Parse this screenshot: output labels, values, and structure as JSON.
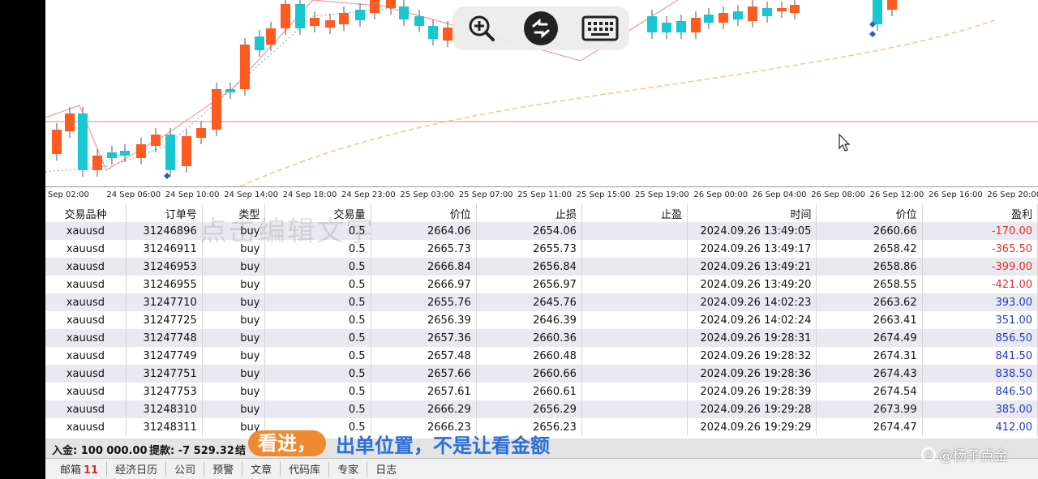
{
  "chart": {
    "time_labels": [
      "Sep 02:00",
      "24 Sep 06:00",
      "24 Sep 10:00",
      "24 Sep 14:00",
      "24 Sep 18:00",
      "24 Sep 23:00",
      "25 Sep 03:00",
      "25 Sep 07:00",
      "25 Sep 11:00",
      "25 Sep 15:00",
      "25 Sep 19:00",
      "26 Sep 00:00",
      "26 Sep 04:00",
      "26 Sep 08:00",
      "26 Sep 12:00",
      "26 Sep 16:00",
      "26 Sep 20:00"
    ]
  },
  "toolbar": {
    "zoom_icon": "zoom-in-icon",
    "remote_icon": "remote-desktop-icon",
    "keyboard_icon": "keyboard-icon"
  },
  "table": {
    "headers": [
      "交易品种",
      "订单号",
      "类型",
      "交易量",
      "价位",
      "止损",
      "止盈",
      "时间",
      "价位",
      "盈利"
    ],
    "rows": [
      {
        "symbol": "xauusd",
        "order": "31246896",
        "type": "buy",
        "volume": "0.5",
        "price": "2664.06",
        "sl": "2654.06",
        "tp": "",
        "time": "2024.09.26 13:49:05",
        "current": "2660.66",
        "profit": "-170.00"
      },
      {
        "symbol": "xauusd",
        "order": "31246911",
        "type": "buy",
        "volume": "0.5",
        "price": "2665.73",
        "sl": "2655.73",
        "tp": "",
        "time": "2024.09.26 13:49:17",
        "current": "2658.42",
        "profit": "-365.50"
      },
      {
        "symbol": "xauusd",
        "order": "31246953",
        "type": "buy",
        "volume": "0.5",
        "price": "2666.84",
        "sl": "2656.84",
        "tp": "",
        "time": "2024.09.26 13:49:21",
        "current": "2658.86",
        "profit": "-399.00"
      },
      {
        "symbol": "xauusd",
        "order": "31246955",
        "type": "buy",
        "volume": "0.5",
        "price": "2666.97",
        "sl": "2656.97",
        "tp": "",
        "time": "2024.09.26 13:49:20",
        "current": "2658.55",
        "profit": "-421.00"
      },
      {
        "symbol": "xauusd",
        "order": "31247710",
        "type": "buy",
        "volume": "0.5",
        "price": "2655.76",
        "sl": "2645.76",
        "tp": "",
        "time": "2024.09.26 14:02:23",
        "current": "2663.62",
        "profit": "393.00"
      },
      {
        "symbol": "xauusd",
        "order": "31247725",
        "type": "buy",
        "volume": "0.5",
        "price": "2656.39",
        "sl": "2646.39",
        "tp": "",
        "time": "2024.09.26 14:02:24",
        "current": "2663.41",
        "profit": "351.00"
      },
      {
        "symbol": "xauusd",
        "order": "31247748",
        "type": "buy",
        "volume": "0.5",
        "price": "2657.36",
        "sl": "2660.36",
        "tp": "",
        "time": "2024.09.26 19:28:31",
        "current": "2674.49",
        "profit": "856.50"
      },
      {
        "symbol": "xauusd",
        "order": "31247749",
        "type": "buy",
        "volume": "0.5",
        "price": "2657.48",
        "sl": "2660.48",
        "tp": "",
        "time": "2024.09.26 19:28:32",
        "current": "2674.31",
        "profit": "841.50"
      },
      {
        "symbol": "xauusd",
        "order": "31247751",
        "type": "buy",
        "volume": "0.5",
        "price": "2657.66",
        "sl": "2660.66",
        "tp": "",
        "time": "2024.09.26 19:28:36",
        "current": "2674.43",
        "profit": "838.50"
      },
      {
        "symbol": "xauusd",
        "order": "31247753",
        "type": "buy",
        "volume": "0.5",
        "price": "2657.61",
        "sl": "2660.61",
        "tp": "",
        "time": "2024.09.26 19:28:39",
        "current": "2674.54",
        "profit": "846.50"
      },
      {
        "symbol": "xauusd",
        "order": "31248310",
        "type": "buy",
        "volume": "0.5",
        "price": "2666.29",
        "sl": "2656.29",
        "tp": "",
        "time": "2024.09.26 19:29:28",
        "current": "2673.99",
        "profit": "385.00"
      },
      {
        "symbol": "xauusd",
        "order": "31248311",
        "type": "buy",
        "volume": "0.5",
        "price": "2666.23",
        "sl": "2656.23",
        "tp": "",
        "time": "2024.09.26 19:29:29",
        "current": "2674.47",
        "profit": "412.00"
      }
    ]
  },
  "watermark": "点击编辑文字",
  "balance": {
    "deposit": "入金: 100 000.00",
    "withdraw": "提款: -7 529.32",
    "tail": "结"
  },
  "tabs": [
    {
      "label": "邮箱",
      "badge": "11"
    },
    {
      "label": "经济日历",
      "badge": ""
    },
    {
      "label": "公司",
      "badge": ""
    },
    {
      "label": "预警",
      "badge": ""
    },
    {
      "label": "文章",
      "badge": ""
    },
    {
      "label": "代码库",
      "badge": ""
    },
    {
      "label": "专家",
      "badge": ""
    },
    {
      "label": "日志",
      "badge": ""
    }
  ],
  "caption": {
    "highlight": "看进，",
    "text": "出单位置，不是让看金额"
  },
  "credit": "@杨子点金",
  "colors": {
    "bull": "#19c7d2",
    "bear": "#ff5a1f",
    "loss": "#e03030",
    "gain": "#2835d0",
    "hline": "#f08080"
  }
}
